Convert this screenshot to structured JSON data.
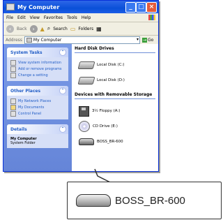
{
  "window": {
    "title": "My Computer",
    "controls": [
      "_",
      "□",
      "×"
    ]
  },
  "menubar": [
    "File",
    "Edit",
    "View",
    "Favorites",
    "Tools",
    "Help"
  ],
  "toolbar": {
    "back": "Back",
    "search": "Search",
    "folders": "Folders"
  },
  "address": {
    "label": "Address",
    "value": "My Computer",
    "go": "Go"
  },
  "left_pane": {
    "system_tasks": {
      "title": "System Tasks",
      "items": [
        "View system information",
        "Add or remove programs",
        "Change a setting"
      ]
    },
    "other_places": {
      "title": "Other Places",
      "items": [
        "My Network Places",
        "My Documents",
        "Control Panel"
      ]
    },
    "details": {
      "title": "Details",
      "name": "My Computer",
      "type": "System Folder"
    }
  },
  "right_pane": {
    "hard_disks": {
      "title": "Hard Disk Drives",
      "items": [
        "Local Disk (C:)",
        "Local Disk (D:)"
      ]
    },
    "removable": {
      "title": "Devices with Removable Storage",
      "items": [
        "3½ Floppy (A:)",
        "CD Drive (E:)",
        "BOSS_BR-600"
      ]
    }
  },
  "callout": {
    "label": "BOSS_BR-600"
  }
}
